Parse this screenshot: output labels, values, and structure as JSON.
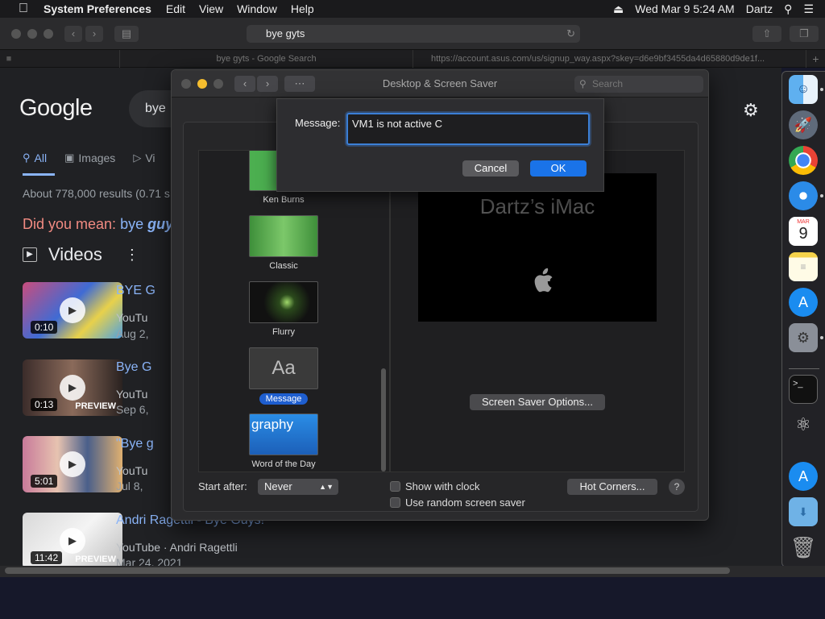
{
  "menubar": {
    "app": "System Preferences",
    "items": [
      "Edit",
      "View",
      "Window",
      "Help"
    ],
    "datetime": "Wed Mar 9  5:24 AM",
    "user": "Dartz"
  },
  "safari": {
    "url": "bye gyts",
    "tabs": [
      "bye gyts - Google Search",
      "https://account.asus.com/us/signup_way.aspx?skey=d6e9bf3455da4d65880d9de1f..."
    ]
  },
  "google": {
    "logo": "Google",
    "query": "bye",
    "tabs": [
      "All",
      "Images",
      "Vi"
    ],
    "results": "About 778,000 results (0.71 s",
    "did_you_mean_label": "Did you mean:",
    "did_you_mean_plain": "bye ",
    "did_you_mean_bold": "guy",
    "videos_heading": "Videos",
    "videos": [
      {
        "title": "BYE G",
        "source": "YouTu",
        "date": "Aug 2,",
        "duration": "0:10",
        "preview": ""
      },
      {
        "title": "Bye G",
        "source": "YouTu",
        "date": "Sep 6,",
        "duration": "0:13",
        "preview": "PREVIEW"
      },
      {
        "title": "\"Bye g",
        "source": "YouTu",
        "date": "Jul 8, ",
        "duration": "5:01",
        "preview": ""
      },
      {
        "title": "Andri Ragettli - Bye Guys!",
        "source": "YouTube · Andri Ragettli",
        "date": "Mar 24, 2021",
        "duration": "11:42",
        "preview": "PREVIEW"
      }
    ]
  },
  "window": {
    "title": "Desktop & Screen Saver",
    "search_placeholder": "Search",
    "savers": [
      {
        "label": "Ken Burns",
        "color": "#4caf50"
      },
      {
        "label": "Classic",
        "color": "#5fb55a"
      },
      {
        "label": "Flurry",
        "color": "#1b1b1b"
      },
      {
        "label": "Message",
        "color": "#3a3a3a",
        "thumb_text": "Aa"
      },
      {
        "label": "Word of the Day",
        "color": "#2a7de1",
        "thumb_text": "graphy"
      }
    ],
    "selected_saver": "Message",
    "preview_name": "Dartz’s iMac",
    "screen_saver_options": "Screen Saver Options...",
    "start_after_label": "Start after:",
    "start_after_value": "Never",
    "show_with_clock": "Show with clock",
    "use_random": "Use random screen saver",
    "hot_corners": "Hot Corners...",
    "help": "?"
  },
  "sheet": {
    "label": "Message:",
    "value": "VM1 is not active C",
    "cancel": "Cancel",
    "ok": "OK"
  },
  "dock": {
    "items": [
      "finder-icon",
      "launchpad-icon",
      "chrome-icon",
      "safari-icon",
      "calendar-icon",
      "notes-icon",
      "app-store-icon",
      "system-preferences-icon",
      "terminal-icon",
      "automator-icon",
      "app-store-downloads-icon",
      "downloads-folder-icon",
      "trash-icon"
    ],
    "calendar_month": "MAR",
    "calendar_day": "9"
  }
}
